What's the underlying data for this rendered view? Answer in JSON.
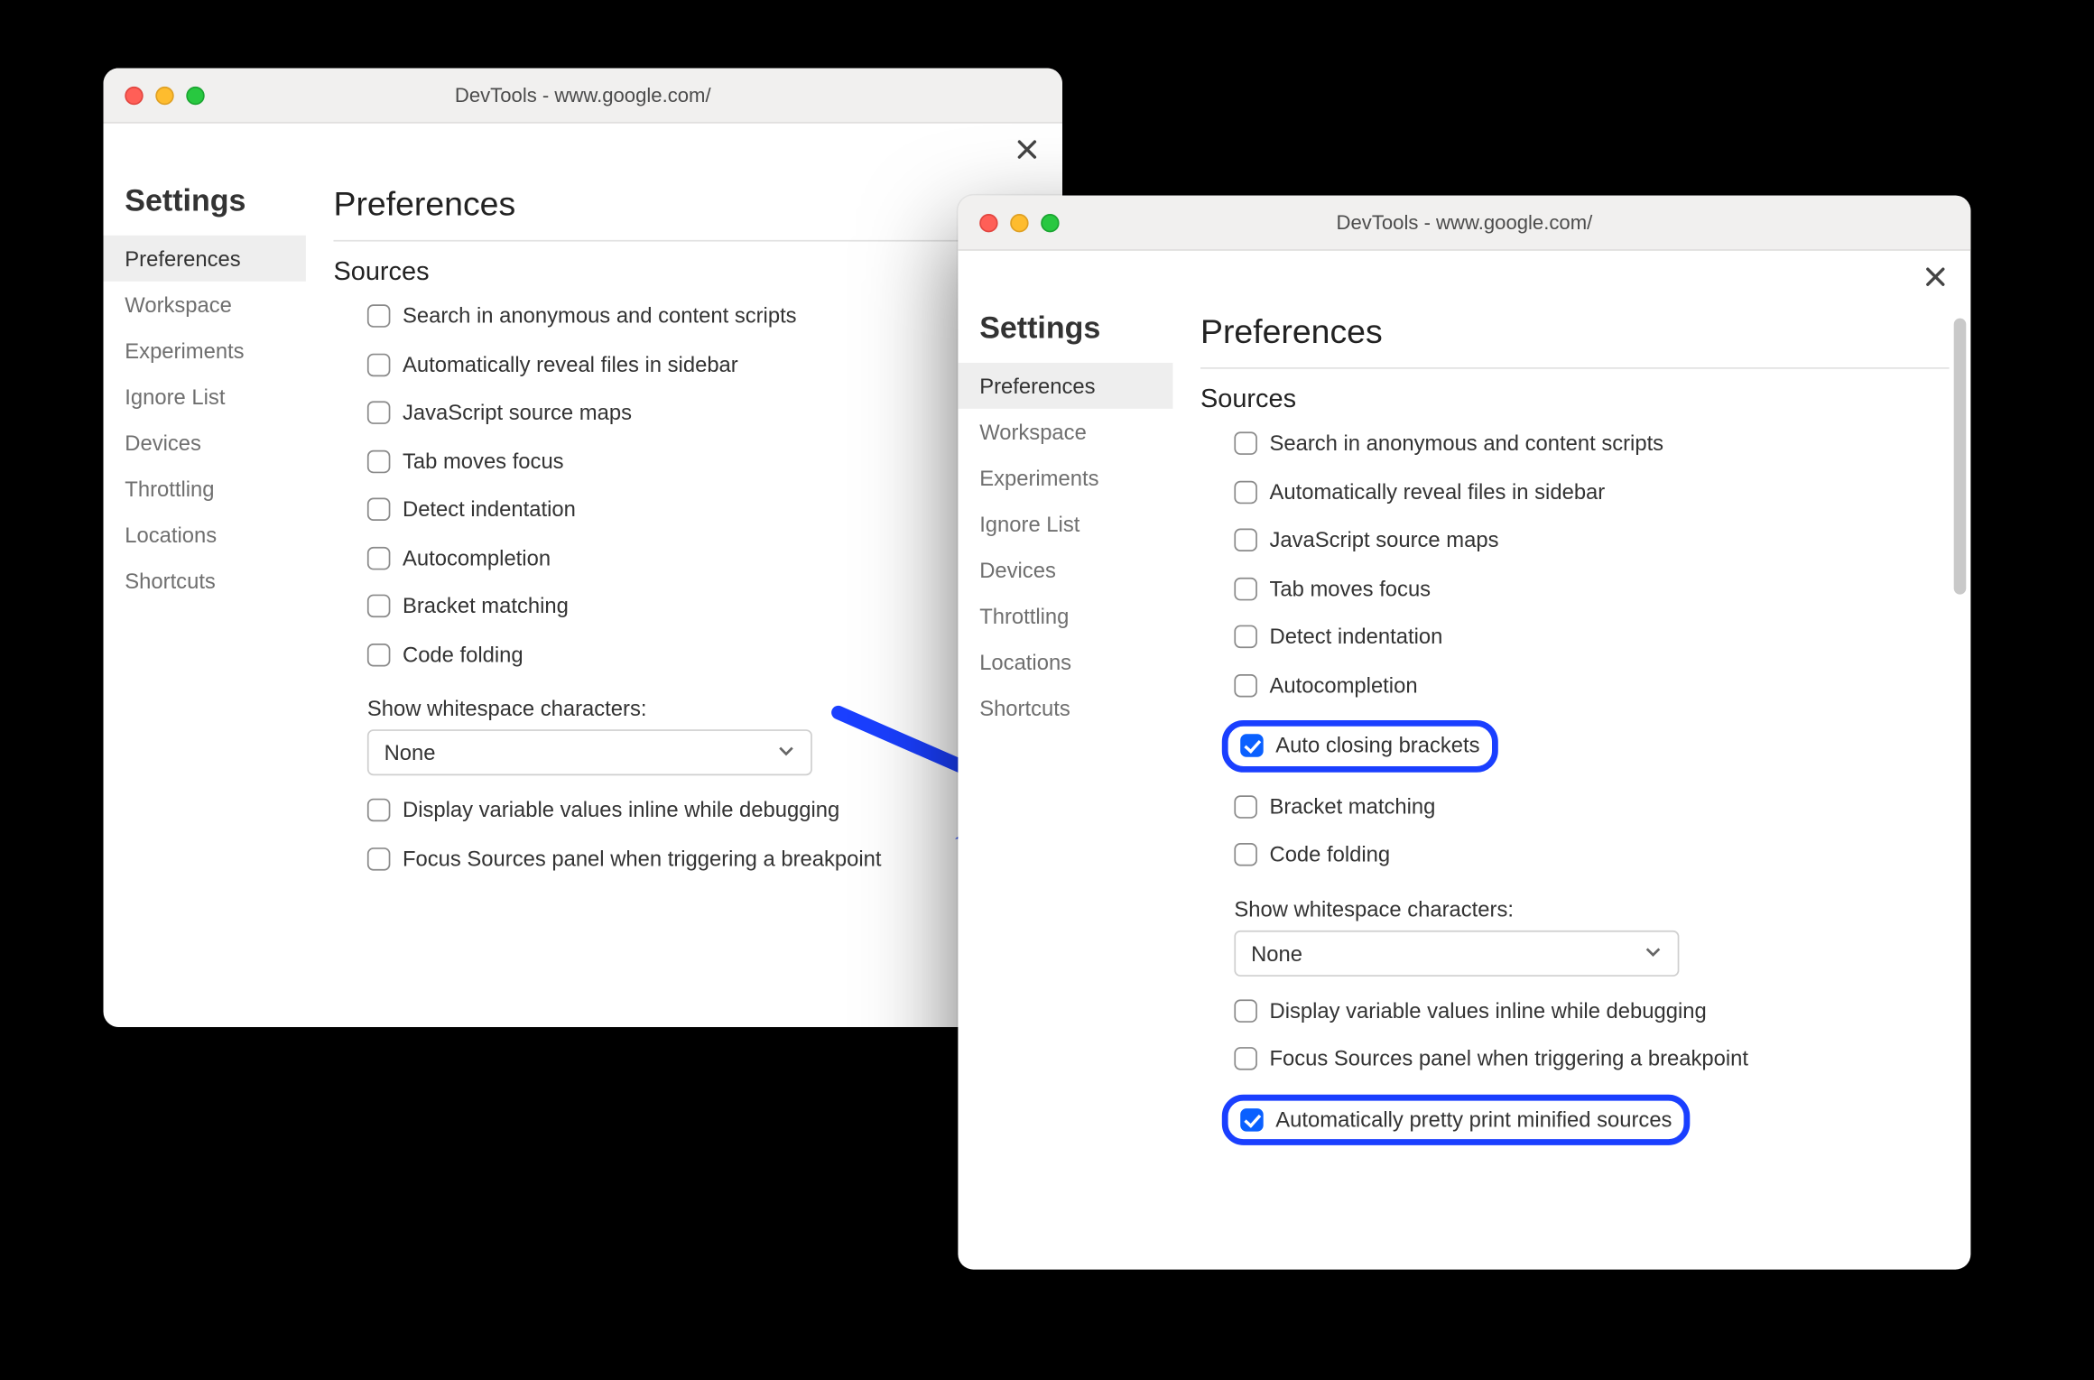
{
  "window_title": "DevTools - www.google.com/",
  "sidebar": {
    "title": "Settings",
    "items": [
      "Preferences",
      "Workspace",
      "Experiments",
      "Ignore List",
      "Devices",
      "Throttling",
      "Locations",
      "Shortcuts"
    ],
    "active_index": 0
  },
  "main": {
    "title": "Preferences",
    "section": "Sources",
    "whitespace_label": "Show whitespace characters:",
    "whitespace_value": "None"
  },
  "left_options": [
    {
      "label": "Search in anonymous and content scripts",
      "checked": false
    },
    {
      "label": "Automatically reveal files in sidebar",
      "checked": false
    },
    {
      "label": "JavaScript source maps",
      "checked": false
    },
    {
      "label": "Tab moves focus",
      "checked": false
    },
    {
      "label": "Detect indentation",
      "checked": false
    },
    {
      "label": "Autocompletion",
      "checked": false
    },
    {
      "label": "Bracket matching",
      "checked": false
    },
    {
      "label": "Code folding",
      "checked": false
    }
  ],
  "left_after": [
    {
      "label": "Display variable values inline while debugging",
      "checked": false
    },
    {
      "label": "Focus Sources panel when triggering a breakpoint",
      "checked": false
    }
  ],
  "right_options": [
    {
      "label": "Search in anonymous and content scripts",
      "checked": false,
      "highlight": false
    },
    {
      "label": "Automatically reveal files in sidebar",
      "checked": false,
      "highlight": false
    },
    {
      "label": "JavaScript source maps",
      "checked": false,
      "highlight": false
    },
    {
      "label": "Tab moves focus",
      "checked": false,
      "highlight": false
    },
    {
      "label": "Detect indentation",
      "checked": false,
      "highlight": false
    },
    {
      "label": "Autocompletion",
      "checked": false,
      "highlight": false
    },
    {
      "label": "Auto closing brackets",
      "checked": true,
      "highlight": true
    },
    {
      "label": "Bracket matching",
      "checked": false,
      "highlight": false
    },
    {
      "label": "Code folding",
      "checked": false,
      "highlight": false
    }
  ],
  "right_after": [
    {
      "label": "Display variable values inline while debugging",
      "checked": false,
      "highlight": false
    },
    {
      "label": "Focus Sources panel when triggering a breakpoint",
      "checked": false,
      "highlight": false
    },
    {
      "label": "Automatically pretty print minified sources",
      "checked": true,
      "highlight": true
    }
  ],
  "colors": {
    "highlight": "#1a3fff",
    "accent": "#0a60ff"
  }
}
